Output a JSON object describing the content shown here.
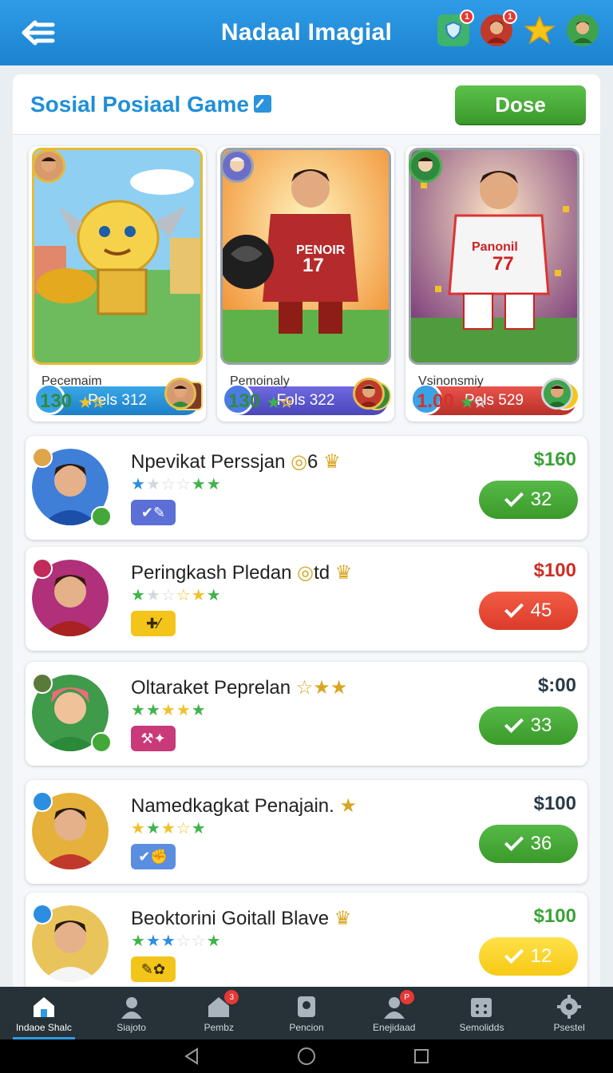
{
  "app_title": "Nadaal Imagial",
  "top_icons": [
    {
      "name": "shield-icon",
      "badge": "1"
    },
    {
      "name": "profile-avatar",
      "badge": "1"
    },
    {
      "name": "star-icon",
      "badge": ""
    },
    {
      "name": "friend-avatar",
      "badge": ""
    }
  ],
  "panel": {
    "title": "Sosial Posiaal Game",
    "done_label": "Dose"
  },
  "featured": [
    {
      "bar_label": "Pels 312",
      "name": "Pecemaim",
      "score": "130"
    },
    {
      "bar_label": "Fols 322",
      "name": "Pemoinaly",
      "score": "130"
    },
    {
      "bar_label": "Pels 529",
      "name": "Vsinonsmiy",
      "score": "1.00"
    }
  ],
  "rows": [
    {
      "name": "Npevikat Perssjan",
      "suffix": "6",
      "price": "$160",
      "price_color": "#3aa236",
      "btn_label": "32",
      "btn_style": "green"
    },
    {
      "name": "Peringkash Pledan",
      "suffix": "td",
      "price": "$100",
      "price_color": "#cc2e24",
      "btn_label": "45",
      "btn_style": "red"
    },
    {
      "name": "Oltaraket Peprelan",
      "suffix": "",
      "price": "$:00",
      "price_color": "#2b3a48",
      "btn_label": "33",
      "btn_style": "green"
    },
    {
      "name": "Namedkagkat Penajain.",
      "suffix": "",
      "price": "$100",
      "price_color": "#2b3a48",
      "btn_label": "36",
      "btn_style": "green"
    },
    {
      "name": "Beoktorini Goitall Blave",
      "suffix": "",
      "price": "$100",
      "price_color": "#3aa236",
      "btn_label": "12",
      "btn_style": "yellow"
    }
  ],
  "bottom_nav": [
    {
      "label": "Indaoe Shalc",
      "badge": ""
    },
    {
      "label": "Siajoto",
      "badge": ""
    },
    {
      "label": "Pembz",
      "badge": "3"
    },
    {
      "label": "Pencion",
      "badge": ""
    },
    {
      "label": "Enejidaad",
      "badge": "P"
    },
    {
      "label": "Semolidds",
      "badge": ""
    },
    {
      "label": "Psestel",
      "badge": ""
    }
  ]
}
